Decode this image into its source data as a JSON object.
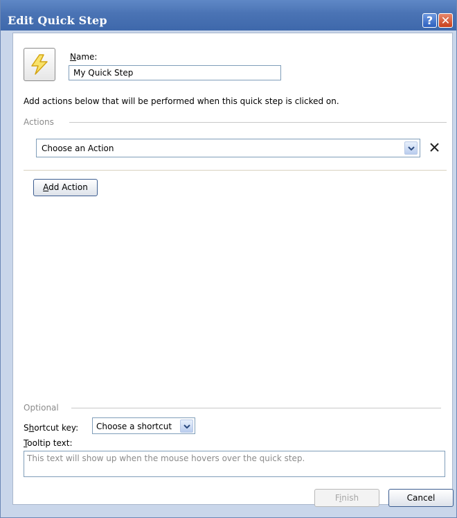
{
  "window": {
    "title": "Edit Quick Step",
    "help_glyph": "?",
    "close_glyph": "✕"
  },
  "name": {
    "label_mnemonic": "N",
    "label_rest": "ame:",
    "value": "My Quick Step"
  },
  "description": "Add actions below that will be performed when this quick step is clicked on.",
  "actions": {
    "section_label": "Actions",
    "selected_action": "Choose an Action",
    "add_mnemonic": "A",
    "add_rest": "dd Action"
  },
  "optional": {
    "section_label": "Optional",
    "shortcut_label_pre": "S",
    "shortcut_label_mnemonic": "h",
    "shortcut_label_post": "ortcut key:",
    "shortcut_value": "Choose a shortcut",
    "tooltip_label_mnemonic": "T",
    "tooltip_label_rest": "ooltip text:",
    "tooltip_placeholder": "This text will show up when the mouse hovers over the quick step."
  },
  "footer": {
    "finish_pre": "F",
    "finish_mnemonic": "i",
    "finish_post": "nish",
    "cancel": "Cancel"
  },
  "icons": {
    "quick_step_icon": "lightning-bolt-icon"
  },
  "colors": {
    "titlebar": "#4a73b4",
    "frame": "#c9d6ea",
    "border": "#7f9db9"
  }
}
